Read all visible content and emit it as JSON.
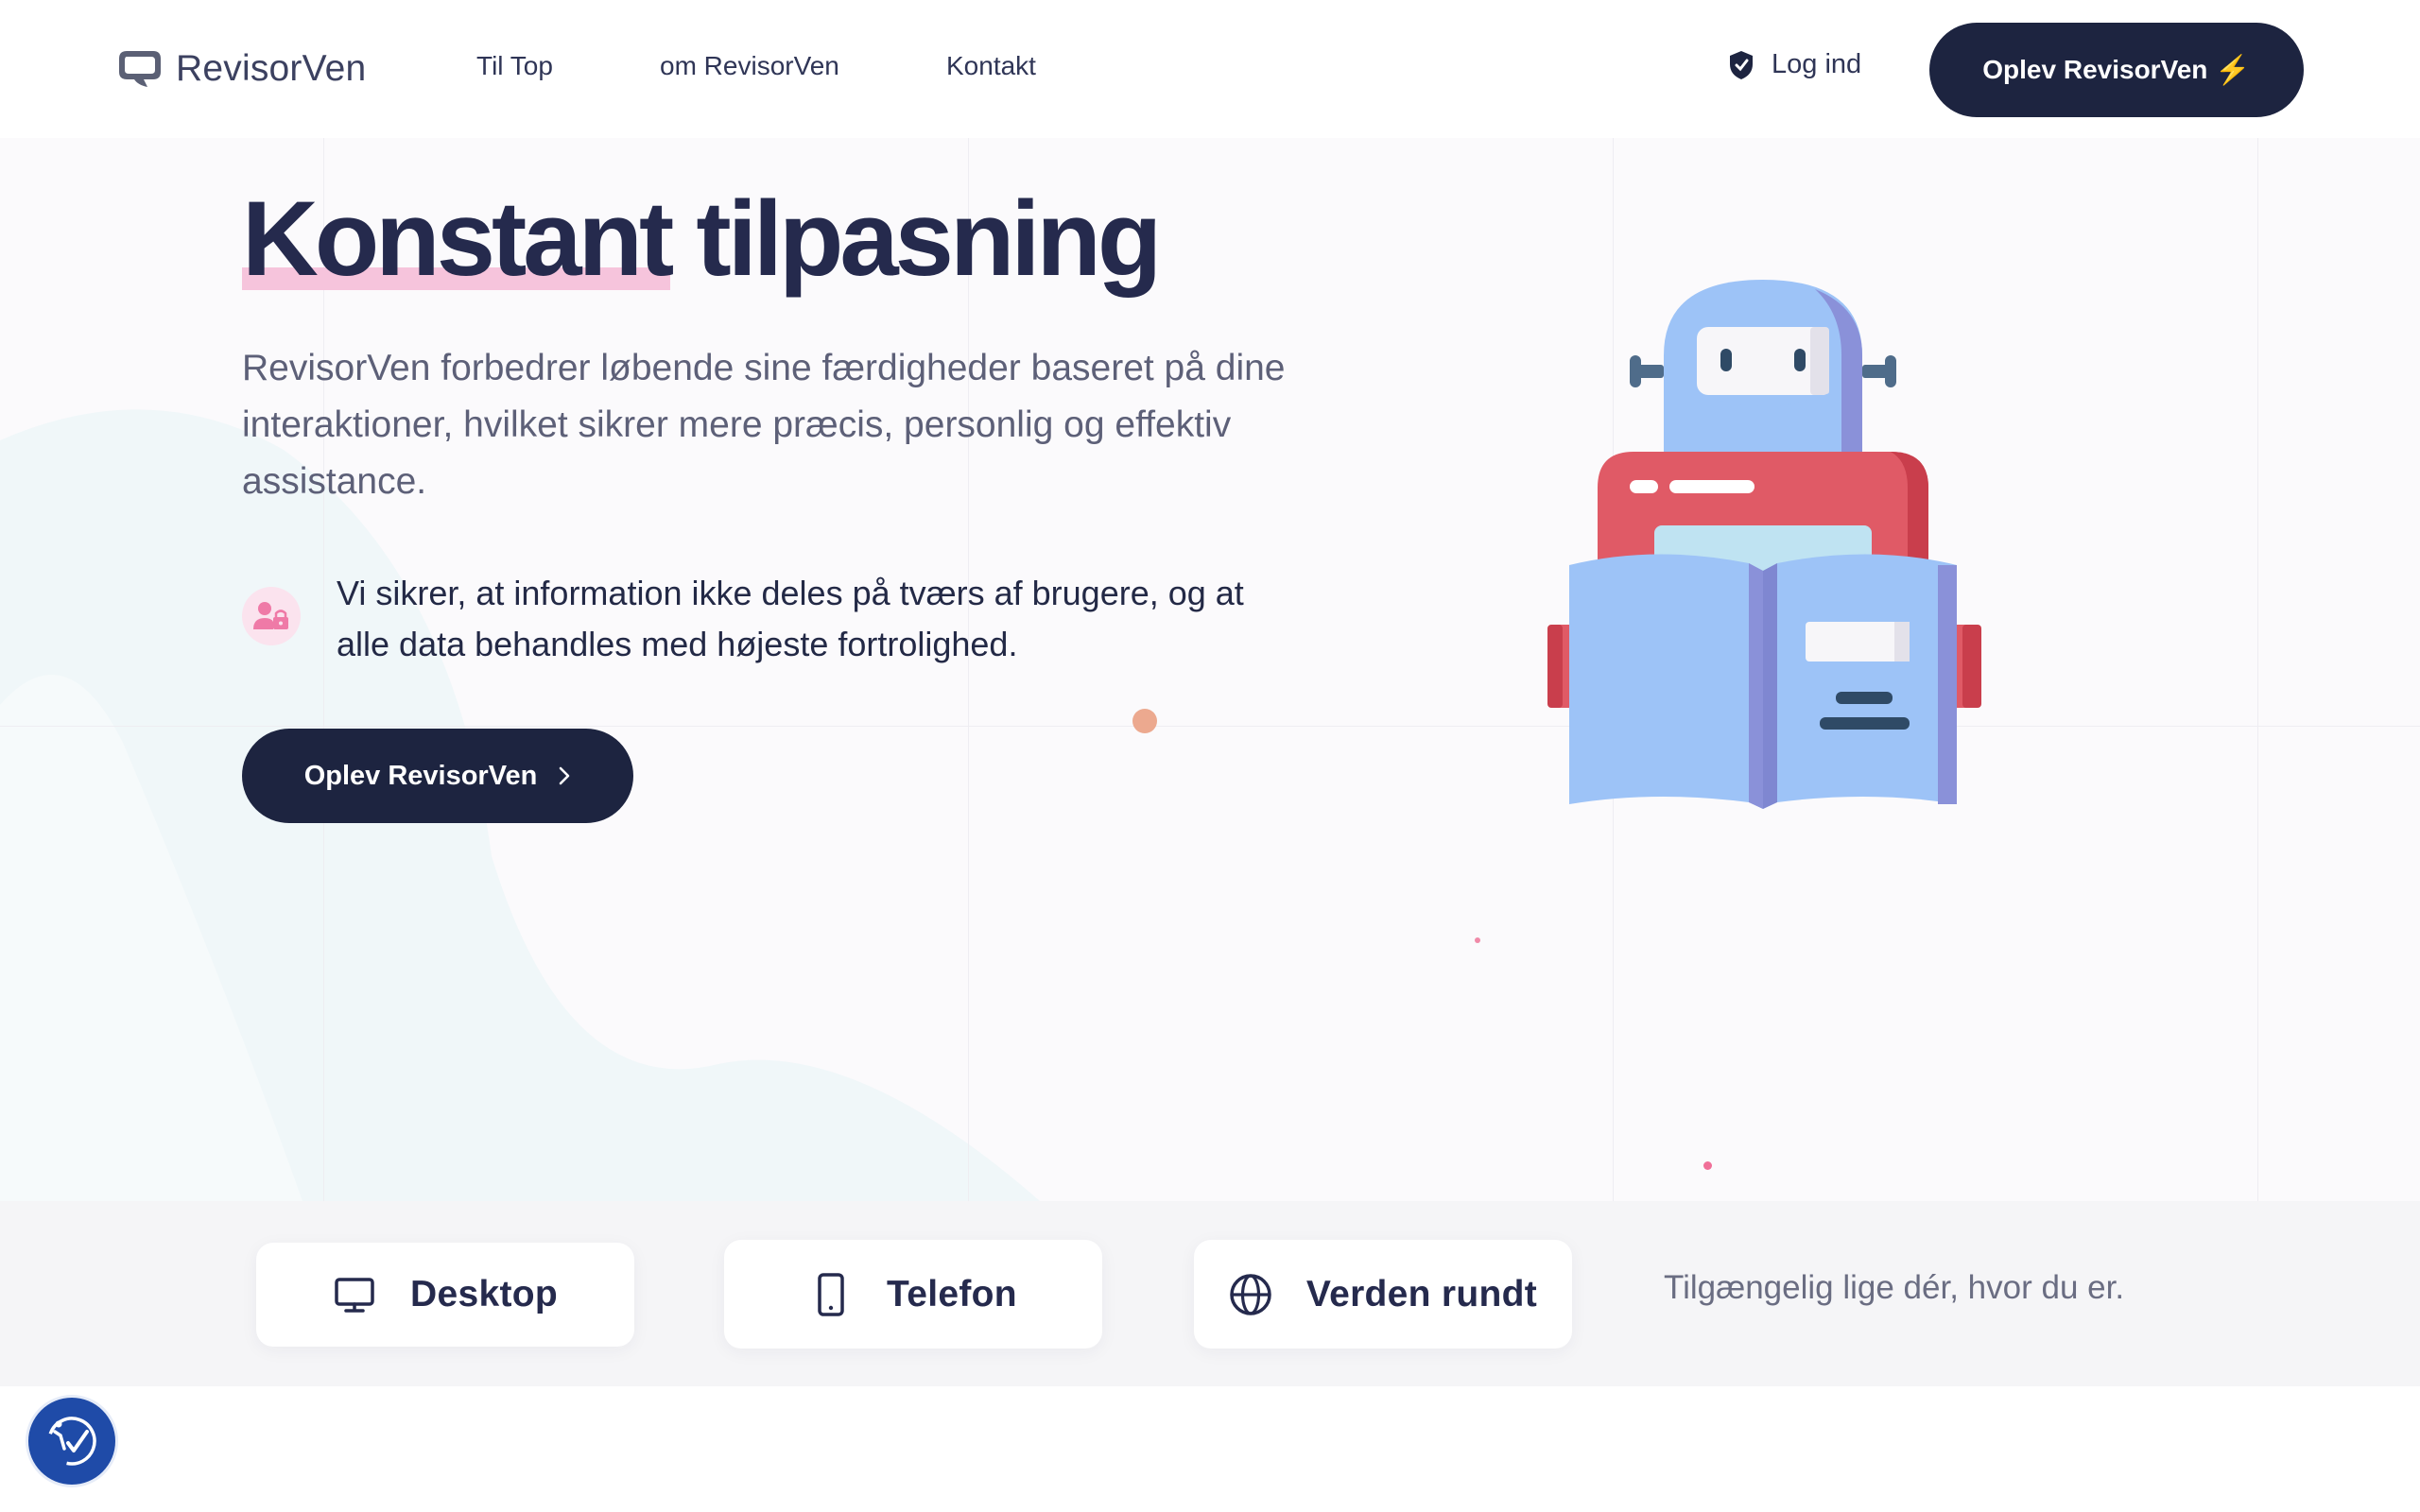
{
  "header": {
    "logo_text": "RevisorVen",
    "nav": [
      "Til Top",
      "om RevisorVen",
      "Kontakt"
    ],
    "login_label": "Log ind",
    "cta_label": "Oplev RevisorVen",
    "cta_icon": "lightning-icon"
  },
  "hero": {
    "title_highlight": "Konstant",
    "title_rest": "tilpasning",
    "description": "RevisorVen forbedrer løbende sine færdigheder baseret på dine interaktioner, hvilket sikrer mere præcis, personlig og effektiv assistance.",
    "privacy_text": "Vi sikrer, at information ikke deles på tværs af brugere, og at alle data behandles med højeste fortrolighed.",
    "privacy_icon": "user-lock-icon",
    "cta_label": "Oplev RevisorVen",
    "illustration": "robot-reading-book"
  },
  "platforms": {
    "items": [
      {
        "label": "Desktop",
        "icon": "monitor-icon"
      },
      {
        "label": "Telefon",
        "icon": "phone-icon"
      },
      {
        "label": "Verden rundt",
        "icon": "globe-icon"
      }
    ],
    "tagline": "Tilgængelig lige dér, hvor du er."
  },
  "accessibility_button_icon": "accessibility-icon",
  "colors": {
    "navy": "#1d2440",
    "highlight_pink": "#f6c4dc",
    "robot_blue": "#9dc3f7",
    "robot_red": "#e05a66"
  }
}
